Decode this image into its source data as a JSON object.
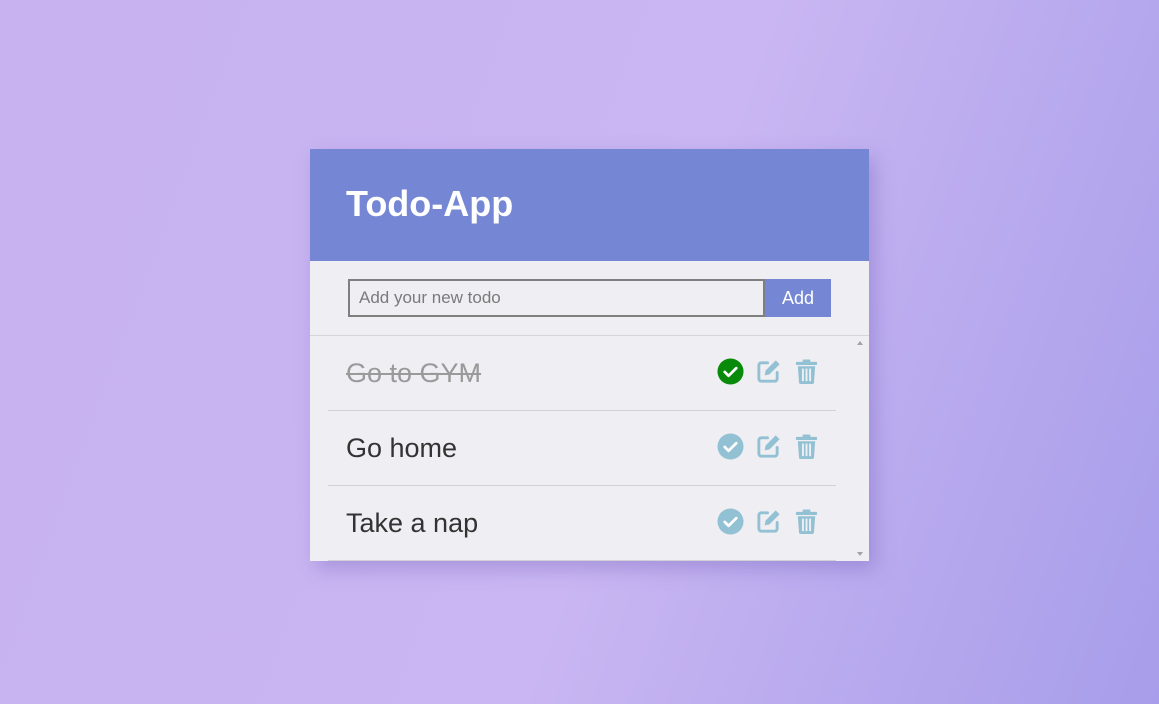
{
  "app": {
    "title": "Todo-App"
  },
  "form": {
    "placeholder": "Add your new todo",
    "value": "",
    "add_label": "Add"
  },
  "todos": [
    {
      "text": "Go to GYM",
      "completed": true
    },
    {
      "text": "Go home",
      "completed": false
    },
    {
      "text": "Take a nap",
      "completed": false
    }
  ],
  "icons": {
    "complete": "check-circle-icon",
    "edit": "pen-to-square-icon",
    "delete": "trash-icon"
  },
  "colors": {
    "header": "#7587d4",
    "accent_button": "#7587d4",
    "check_done": "#0a8a0a",
    "icon_default": "#93c1d4"
  }
}
